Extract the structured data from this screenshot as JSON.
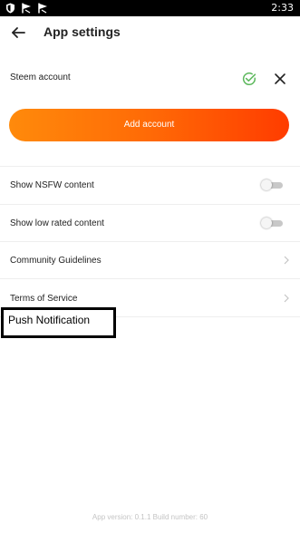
{
  "status_bar": {
    "time": "2:33",
    "icons": [
      "shield-icon",
      "notification-flag-icon",
      "notification-flag-icon"
    ]
  },
  "header": {
    "back_icon": "arrow-left-icon",
    "title": "App settings"
  },
  "account": {
    "label": "Steem account",
    "check_icon": "check-circle-icon",
    "check_color": "#5cb85c",
    "close_icon": "close-icon"
  },
  "add_account": {
    "label": "Add account",
    "gradient_start": "#ff8a0b",
    "gradient_end": "#ff3c00"
  },
  "settings": {
    "nsfw": {
      "label": "Show NSFW content",
      "enabled": false
    },
    "low_rated": {
      "label": "Show low rated content",
      "enabled": false
    },
    "guidelines": {
      "label": "Community Guidelines"
    },
    "terms": {
      "label": "Terms of Service"
    }
  },
  "push_notification": {
    "label": "Push Notification"
  },
  "footer": {
    "version_text": "App version: 0.1.1 Build number: 60"
  }
}
